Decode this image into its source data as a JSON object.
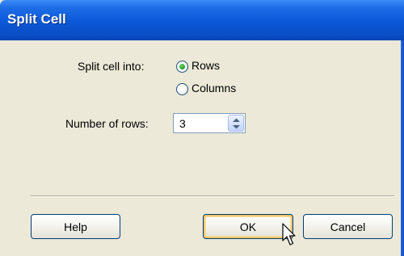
{
  "window": {
    "title": "Split Cell"
  },
  "split": {
    "label": "Split cell into:",
    "options": [
      {
        "label": "Rows",
        "selected": true
      },
      {
        "label": "Columns",
        "selected": false
      }
    ]
  },
  "count": {
    "label": "Number of rows:",
    "value": "3"
  },
  "buttons": {
    "help": "Help",
    "ok": "OK",
    "cancel": "Cancel"
  },
  "colors": {
    "titlebar": "#0b58d6",
    "dialog_bg": "#ece9d8",
    "radio_dot": "#21a121",
    "default_button_glow": "#f7c76a"
  }
}
